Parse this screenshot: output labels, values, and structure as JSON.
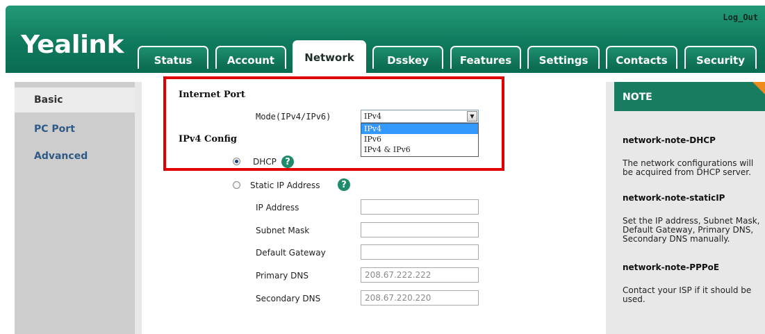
{
  "header": {
    "logo": "Yealink",
    "logout_label": "Log_Out",
    "tabs": [
      {
        "label": "Status"
      },
      {
        "label": "Account"
      },
      {
        "label": "Network"
      },
      {
        "label": "Dsskey"
      },
      {
        "label": "Features"
      },
      {
        "label": "Settings"
      },
      {
        "label": "Contacts"
      },
      {
        "label": "Security"
      }
    ],
    "active_tab": "Network"
  },
  "sidebar": {
    "items": [
      {
        "label": "Basic"
      },
      {
        "label": "PC Port"
      },
      {
        "label": "Advanced"
      }
    ],
    "active_item": "Basic"
  },
  "form": {
    "internet_port_title": "Internet Port",
    "mode_label": "Mode(IPv4/IPv6)",
    "mode_value": "IPv4",
    "mode_options": [
      "IPv4",
      "IPv6",
      "IPv4 & IPv6"
    ],
    "highlighted_option": "IPv4",
    "ipv4_config_title": "IPv4 Config",
    "dhcp_label": "DHCP",
    "static_label": "Static IP Address",
    "selected_mode": "DHCP",
    "help_glyph": "?",
    "fields": [
      {
        "label": "IP Address",
        "value": ""
      },
      {
        "label": "Subnet Mask",
        "value": ""
      },
      {
        "label": "Default Gateway",
        "value": ""
      },
      {
        "label": "Primary DNS",
        "value": "208.67.222.222"
      },
      {
        "label": "Secondary DNS",
        "value": "208.67.220.220"
      }
    ]
  },
  "note": {
    "title": "NOTE",
    "sections": [
      {
        "key": "network-note-DHCP",
        "text": "The network configurations will be acquired from DHCP server."
      },
      {
        "key": "network-note-staticIP",
        "text": "Set the IP address, Subnet Mask, Default Gateway, Primary DNS, Secondary DNS manually."
      },
      {
        "key": "network-note-PPPoE",
        "text": "Contact your ISP if it should be used."
      }
    ]
  },
  "colors": {
    "header_green": "#0f7a5d",
    "note_header": "#187d60",
    "note_corner": "#f08a1c",
    "highlight_border": "#e00000",
    "help_icon": "#1e8b6b",
    "sidebar_link": "#2f5a86"
  },
  "icons": {
    "help": "question-circle-icon",
    "dropdown": "chevron-down-icon",
    "note_corner": "fold-corner-icon"
  }
}
